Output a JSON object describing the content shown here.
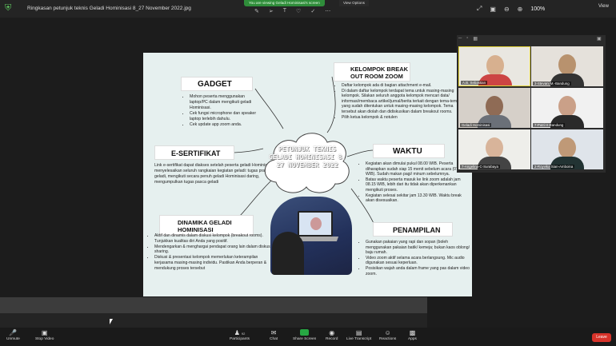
{
  "topbar": {
    "doc_title": "Ringkasan petunjuk teknis Geladi Hominisasi 8_27 November 2022.jpg",
    "viewing_banner": "You are viewing Geladi Hominisasi's screen",
    "view_options": "View Options",
    "zoom": "100%",
    "view_label": "View"
  },
  "slide": {
    "cloud_title": "PETUNJUK TEKNIS GELADI HOMINISASI 8, 27 NOVEMBER 2022",
    "gadget": {
      "title": "GADGET",
      "items": [
        "Mohon peserta menggunakan laptop/PC dalam mengikuti geladi Hominisasi.",
        "Cek fungsi microphone dan speaker laptop terlebih dahulu.",
        "Cek update app zoom anda."
      ]
    },
    "esertifikat": {
      "title": "E-SERTIFIKAT",
      "body": "Link e-sertifikat dapat diakses setelah peserta geladi Hominisasi menyelesaikan seluruh rangkaian kegiatan geladi: tugas pra geladi, mengikuti secara penuh geladi Hominisasi daring, mengumpulkan tugas pasca geladi"
    },
    "dinamika": {
      "title": "DINAMIKA GELADI HOMINISASI",
      "items": [
        "Aktif dan dinamis dalam diskusi kelompok (breakout rooms). Tunjukkan kualitas diri Anda yang positif.",
        "Mendengarkan & menghargai pendapat orang lain dalam diskusi/ sharing.",
        "Diskusi & presentasi kelompok memerlukan keterampilan kerjasama masing-masing individu. Pastikan Anda berperan & mendukung proses tersebut"
      ]
    },
    "kelompok": {
      "title": "KELOMPOK BREAK OUT ROOM ZOOM",
      "items": [
        "Daftar kelompok ada di bagian attachment e-mail.",
        "Di dalam daftar kelompok terdapat tema untuk masing-masing kelompok. Silakan seluruh anggota kelompok mencari data/ informasi/membaca artikel/jurnal/berita terkait dengan tema-tema yang sudah ditentukan untuk masing-masing kelompok. Tema tersebut akan diolah dan didiskusikan dalam breakout rooms.",
        "Pilih ketua kelompok & notulen"
      ]
    },
    "waktu": {
      "title": "WAKTU",
      "items": [
        "Kegiatan akan dimulai pukul 08.00 WIB. Peserta diharapkan sudah siap 15 menit sebelum acara (07.45 WIB). Sudah makan pagi/ minum sebelumnya.",
        "Batas waktu peserta masuk ke link zoom adalah jam 08.15 WIB, lebih dari itu tidak akan diperkenankan mengikuti proses.",
        "Kegiatan selesai sekitar jam 13.30 WIB. Waktu break akan disesuaikan."
      ]
    },
    "penampilan": {
      "title": "PENAMPILAN",
      "items": [
        "Gunakan pakaian yang rapi dan sopan (boleh menggunakan pakaian batik/ kemeja; bukan kaos oblong/ baju rumah.",
        "Video zoom aktif selama acara berlangsung. Mic audio digunakan sesuai keperluan.",
        "Posisikan wajah anda dalam frame yang pas dalam video zoom."
      ]
    }
  },
  "gallery": {
    "participants": [
      {
        "name": "A.B. Sebastian",
        "color": "#d7b08f"
      },
      {
        "name": "3-Stevani M.-Bandung",
        "color": "#b8926e"
      },
      {
        "name": "Geladi Hominisasi",
        "color": "#8f6b55"
      },
      {
        "name": "7-Putri H-Bandung",
        "color": "#caa088"
      },
      {
        "name": "7-Angelina-C-Surabaya",
        "color": "#d8b49a"
      },
      {
        "name": "2-Royvika Sian-Amboina",
        "color": "#bf9977"
      }
    ]
  },
  "toolbar": {
    "unmute": "Unmute",
    "stop_video": "Stop Video",
    "participants": "Participants",
    "participants_count": "92",
    "chat": "Chat",
    "share_screen": "Share Screen",
    "record": "Record",
    "live_transcript": "Live Transcript",
    "reactions": "Reactions",
    "apps": "Apps",
    "leave": "Leave"
  },
  "colors": {
    "accent_green": "#27a843",
    "leave_red": "#d7332a",
    "active_speaker": "#e4d53a"
  }
}
